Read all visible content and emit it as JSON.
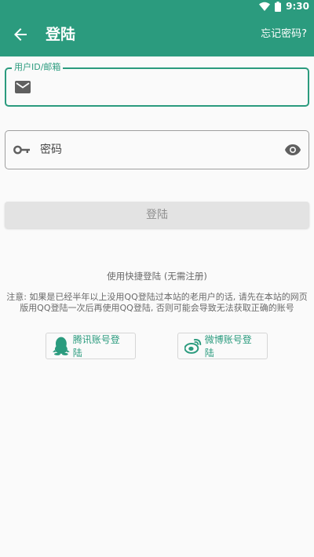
{
  "status_bar": {
    "time": "9:30"
  },
  "app_bar": {
    "title": "登陆",
    "forgot_label": "忘记密码?"
  },
  "form": {
    "user_label": "用户ID/邮箱",
    "user_value": "",
    "password_placeholder": "密码",
    "login_label": "登陆"
  },
  "quick_login": {
    "title": "使用快捷登陆 (无需注册)",
    "notice": "注意: 如果是已经半年以上没用QQ登陆过本站的老用户的话, 请先在本站的网页版用QQ登陆一次后再使用QQ登陆, 否则可能会导致无法获取正确的账号",
    "qq_label": "腾讯账号登陆",
    "weibo_label": "微博账号登陆"
  },
  "colors": {
    "primary": "#2b9b7e",
    "disabled_button": "#e3e3e3"
  }
}
